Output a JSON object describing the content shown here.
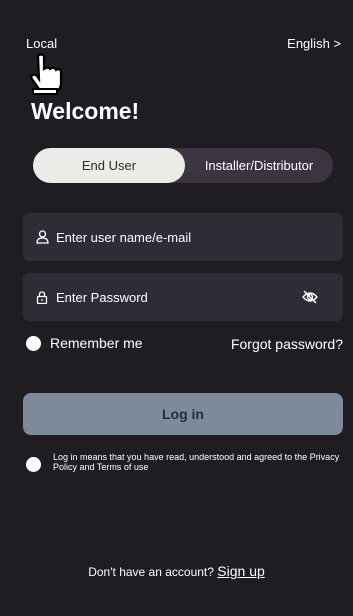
{
  "header": {
    "region_label": "Local",
    "language_label": "English >"
  },
  "icons": {
    "cursor": "hand-pointer-icon",
    "user": "user-icon",
    "lock": "lock-icon",
    "password_toggle": "eye-off-icon"
  },
  "welcome": {
    "title": "Welcome!"
  },
  "segment": {
    "options": [
      "End User",
      "Installer/Distributor"
    ],
    "selected": "End User"
  },
  "form": {
    "username_placeholder": "Enter user name/e-mail",
    "password_placeholder": "Enter Password"
  },
  "remember": {
    "label": "Remember me",
    "checked": false
  },
  "forgot": {
    "label": "Forgot password?"
  },
  "login": {
    "label": "Log in"
  },
  "terms": {
    "text": "Log in means that you have read, understood and agreed to the Privacy Policy and Terms of use",
    "checked": false
  },
  "footer": {
    "prompt": "Don't have an account?",
    "signup_label": "Sign up"
  },
  "colors": {
    "background": "#201d22",
    "field": "#2f2b37",
    "segment_active": "#ecebe8",
    "button": "#7c8a9a"
  }
}
